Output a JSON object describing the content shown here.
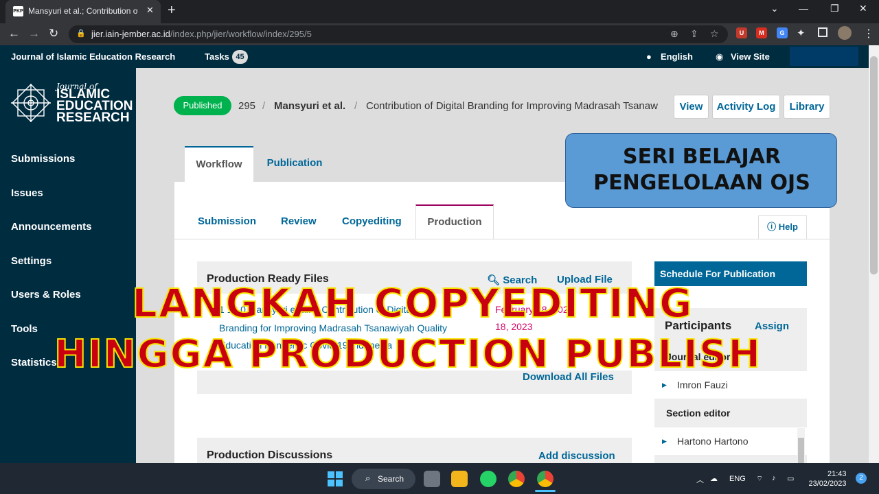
{
  "browser": {
    "tab_title": "Mansyuri et al.; Contribution of Digital Branding",
    "url_host": "jier.iain-jember.ac.id",
    "url_path": "/index.php/jier/workflow/index/295/5"
  },
  "header": {
    "journal_name": "Journal of Islamic Education Research",
    "tasks_label": "Tasks",
    "tasks_count": "45",
    "language": "English",
    "view_site": "View Site"
  },
  "logo": {
    "line1": "Journal of",
    "line2": "ISLAMIC",
    "line3": "EDUCATION",
    "line4": "RESEARCH"
  },
  "sidebar": {
    "items": [
      {
        "label": "Submissions"
      },
      {
        "label": "Issues"
      },
      {
        "label": "Announcements"
      },
      {
        "label": "Settings"
      },
      {
        "label": "Users & Roles"
      },
      {
        "label": "Tools"
      },
      {
        "label": "Statistics"
      }
    ]
  },
  "submission": {
    "status": "Published",
    "id": "295",
    "sep": "/",
    "authors": "Mansyuri et al.",
    "title": "Contribution of Digital Branding for Improving Madrasah Tsanaw",
    "buttons": {
      "view": "View",
      "activity_log": "Activity Log",
      "library": "Library"
    }
  },
  "main_tabs": {
    "workflow": "Workflow",
    "publication": "Publication"
  },
  "stage_tabs": {
    "submission": "Submission",
    "review": "Review",
    "copyediting": "Copyediting",
    "production": "Production"
  },
  "help_label": "Help",
  "production_files": {
    "title": "Production Ready Files",
    "search": "Search",
    "upload": "Upload File",
    "file_line1": "1 12 0 Mansyuri et al. 2  Contribution of Digital",
    "file_line2": "Branding for Improving Madrasah Tsanawiyah Quality",
    "file_line3": "Education   Pandemic Covid 19 Indonesia",
    "date_line1": "February 18, 2023",
    "date_line2": "18, 2023",
    "download_all": "Download All Files"
  },
  "discussions": {
    "title": "Production Discussions",
    "add": "Add discussion"
  },
  "schedule_label": "Schedule For Publication",
  "participants": {
    "title": "Participants",
    "assign": "Assign",
    "roles": [
      {
        "role": "Journal editor",
        "names": [
          "Imron Fauzi"
        ]
      },
      {
        "role": "Section editor",
        "names": [
          "Hartono Hartono"
        ]
      }
    ]
  },
  "overlay": {
    "series_line1": "SERI BELAJAR",
    "series_line2": "PENGELOLAAN OJS",
    "headline1": "LANGKAH COPYEDITING",
    "headline2": "HINGGA PRODUCTION PUBLISH"
  },
  "taskbar": {
    "search": "Search",
    "lang": "ENG",
    "time": "21:43",
    "date": "23/02/2023",
    "notifications": "2"
  },
  "colors": {
    "ojs_dark": "#002c40",
    "link_blue": "#006798",
    "published_green": "#00b24e",
    "overlay_red": "#c8000f",
    "overlay_yellow": "#f5e500"
  }
}
